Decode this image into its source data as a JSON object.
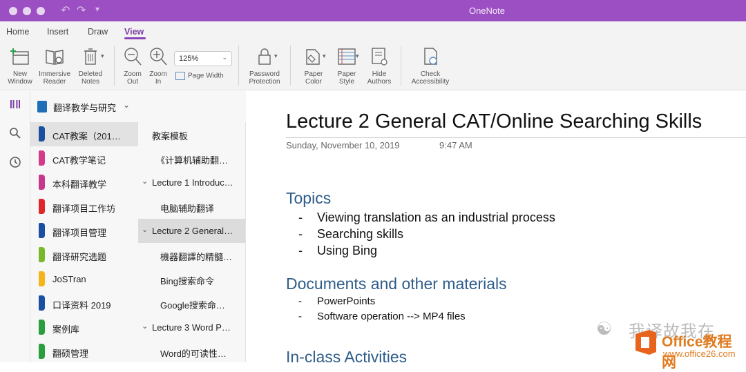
{
  "window": {
    "title": "OneNote"
  },
  "ribbon_tabs": [
    "Home",
    "Insert",
    "Draw",
    "View"
  ],
  "ribbon": {
    "new_window": [
      "New",
      "Window"
    ],
    "immersive_reader": [
      "Immersive",
      "Reader"
    ],
    "deleted_notes": [
      "Deleted",
      "Notes"
    ],
    "zoom_out": [
      "Zoom",
      "Out"
    ],
    "zoom_in": [
      "Zoom",
      "In"
    ],
    "zoom_value": "125%",
    "page_width": "Page Width",
    "password_protection": [
      "Password",
      "Protection"
    ],
    "paper_color": [
      "Paper",
      "Color"
    ],
    "paper_style": [
      "Paper",
      "Style"
    ],
    "hide_authors": [
      "Hide",
      "Authors"
    ],
    "check_accessibility": [
      "Check",
      "Accessibility"
    ]
  },
  "notebook": {
    "title": "翻译教学与研究"
  },
  "sections": [
    {
      "label": "CAT教案（201…",
      "color": "#1b4fa0"
    },
    {
      "label": "CAT教学笔记",
      "color": "#d23a8a"
    },
    {
      "label": "本科翻译教学",
      "color": "#c8378e"
    },
    {
      "label": "翻译项目工作坊",
      "color": "#e0262d"
    },
    {
      "label": "翻译项目管理",
      "color": "#1b4fa0"
    },
    {
      "label": "翻译研究选题",
      "color": "#7ab82b"
    },
    {
      "label": "JoSTran",
      "color": "#f2b51c"
    },
    {
      "label": "口译资料 2019",
      "color": "#1b4fa0"
    },
    {
      "label": "案例库",
      "color": "#2a9e3d"
    },
    {
      "label": "翻硕管理",
      "color": "#2a9e3d"
    }
  ],
  "pages": [
    {
      "label": "教案模板",
      "level": 0,
      "group": false
    },
    {
      "label": "《计算机辅助翻…",
      "level": 0,
      "group": false
    },
    {
      "label": "Lecture 1 Introduc…",
      "level": 0,
      "group": true
    },
    {
      "label": "电脑辅助翻译",
      "level": 1,
      "group": false
    },
    {
      "label": "Lecture 2 General…",
      "level": 0,
      "group": true
    },
    {
      "label": "機器翻譯的精髓…",
      "level": 1,
      "group": false
    },
    {
      "label": "Bing搜索命令",
      "level": 1,
      "group": false
    },
    {
      "label": "Google搜索命…",
      "level": 1,
      "group": false
    },
    {
      "label": "Lecture 3 Word P…",
      "level": 0,
      "group": true
    },
    {
      "label": "Word的可读性…",
      "level": 1,
      "group": false
    }
  ],
  "page": {
    "title": "Lecture 2 General CAT/Online Searching Skills",
    "date": "Sunday, November 10, 2019",
    "time": "9:47 AM",
    "topics_heading": "Topics",
    "topics": [
      "Viewing translation as an industrial process",
      "Searching skills",
      "Using Bing"
    ],
    "docs_heading": "Documents and other materials",
    "docs": [
      "PowerPoints",
      "Software operation --> MP4 files"
    ],
    "activities_heading": "In-class Activities"
  },
  "watermark": {
    "text": "我译故我在",
    "brand": "Office教程网",
    "url": "www.office26.com"
  }
}
